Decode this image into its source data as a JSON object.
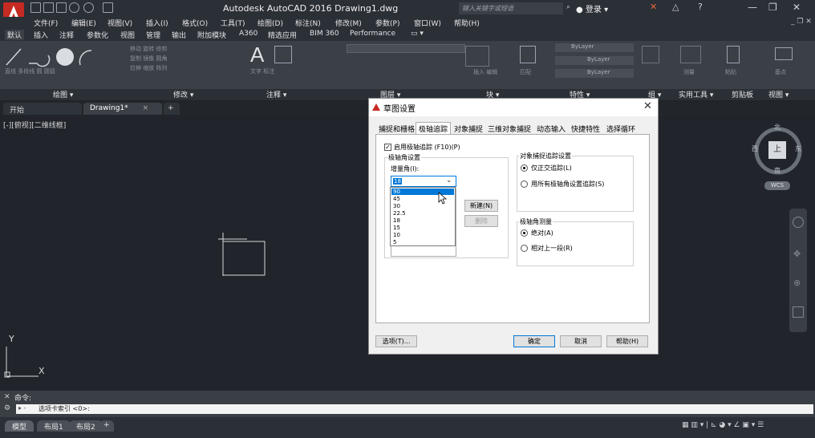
{
  "app": {
    "title": "Autodesk AutoCAD 2016    Drawing1.dwg",
    "search_placeholder": "键入关键字或短语",
    "login": "登录",
    "logo_icon": "autocad-a-icon",
    "brand_color": "#c62a22"
  },
  "menu": [
    "文件(F)",
    "编辑(E)",
    "视图(V)",
    "插入(I)",
    "格式(O)",
    "工具(T)",
    "绘图(D)",
    "标注(N)",
    "修改(M)",
    "参数(P)",
    "窗口(W)",
    "帮助(H)"
  ],
  "ribbon_tabs": [
    "默认",
    "插入",
    "注释",
    "参数化",
    "视图",
    "管理",
    "输出",
    "附加模块",
    "A360",
    "精选应用",
    "BIM 360",
    "Performance"
  ],
  "ribbon_panels": [
    "绘图 ▾",
    "修改 ▾",
    "注释 ▾",
    "图层 ▾",
    "块 ▾",
    "特性 ▾",
    "组 ▾",
    "实用工具 ▾",
    "剪贴板",
    "视图 ▾"
  ],
  "ribbon_buttons": [
    "直线",
    "多段线",
    "圆",
    "圆弧",
    "文字",
    "标注",
    "移动",
    "旋转",
    "修剪",
    "复制",
    "镜像",
    "圆角",
    "拉伸",
    "缩放",
    "阵列",
    "插入",
    "编辑",
    "匹配",
    "测量",
    "粘贴",
    "基点"
  ],
  "bylayer": [
    "ByLayer",
    "ByLayer",
    "ByLayer"
  ],
  "doc_tabs": {
    "start": "开始",
    "drawing": "Drawing1*",
    "add": "+"
  },
  "viewport_label": "[-][俯视][二维线框]",
  "viewcube": {
    "north": "北",
    "south": "南",
    "east": "东",
    "west": "西",
    "top": "上",
    "wcs": "WCS"
  },
  "axes": {
    "x": "X",
    "y": "Y"
  },
  "command": {
    "label": "命令:",
    "prompt": "选项卡索引 <0>:"
  },
  "layout_tabs": [
    "模型",
    "布局1",
    "布局2",
    "+"
  ],
  "dialog": {
    "title": "草图设置",
    "tabs": [
      "捕捉和栅格",
      "极轴追踪",
      "对象捕捉",
      "三维对象捕捉",
      "动态输入",
      "快捷特性",
      "选择循环"
    ],
    "enable_polar": "启用极轴追踪 (F10)(P)",
    "enable_polar_checked": true,
    "polar_angle_settings": "极轴角设置",
    "increment_angle_label": "增量角(I):",
    "increment_value": "18",
    "dropdown_options": [
      "90",
      "45",
      "30",
      "22.5",
      "18",
      "15",
      "10",
      "5"
    ],
    "dropdown_selected": "90",
    "new_button": "新建(N)",
    "delete_button": "删除",
    "object_snap_tracking": "对象捕捉追踪设置",
    "ortho_only": "仅正交追踪(L)",
    "all_polar": "用所有极轴角设置追踪(S)",
    "polar_measure": "极轴角测量",
    "absolute": "绝对(A)",
    "relative": "相对上一段(R)",
    "options_button": "选项(T)...",
    "ok_button": "确定",
    "cancel_button": "取消",
    "help_button": "帮助(H)"
  }
}
